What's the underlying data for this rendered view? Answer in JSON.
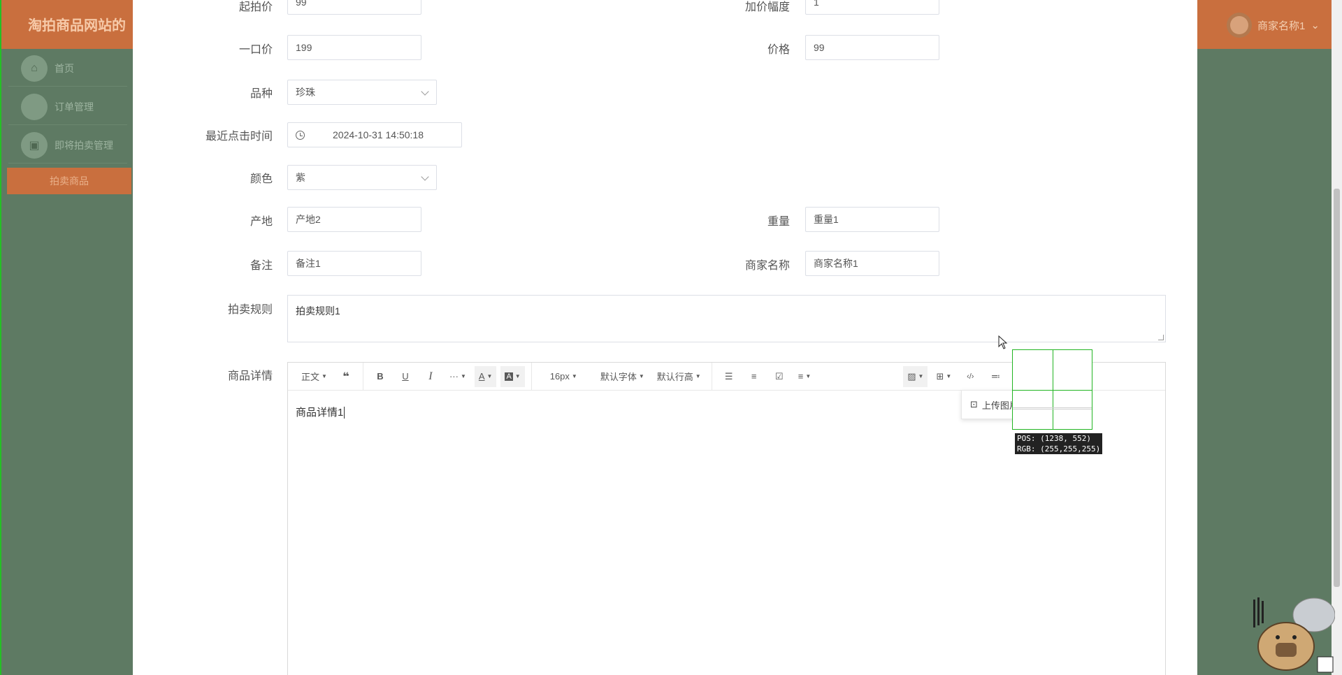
{
  "background_app": {
    "site_title": "淘拍商品网站的",
    "sidebar": [
      {
        "label": "首页",
        "icon": "home-icon"
      },
      {
        "label": "订单管理",
        "icon": "order-icon"
      },
      {
        "label": "即将拍卖管理",
        "icon": "briefcase-icon"
      }
    ],
    "active_menu": "拍卖商品",
    "user_name": "商家名称1"
  },
  "form": {
    "start_price": {
      "label": "起拍价",
      "value": "99"
    },
    "bid_increment": {
      "label": "加价幅度",
      "value": "1"
    },
    "buyout_price": {
      "label": "一口价",
      "value": "199"
    },
    "price": {
      "label": "价格",
      "value": "99"
    },
    "variety": {
      "label": "品种",
      "value": "珍珠"
    },
    "last_click_time": {
      "label": "最近点击时间",
      "value": "2024-10-31 14:50:18"
    },
    "color": {
      "label": "颜色",
      "value": "紫"
    },
    "origin": {
      "label": "产地",
      "value": "产地2"
    },
    "weight": {
      "label": "重量",
      "value": "重量1"
    },
    "remark": {
      "label": "备注",
      "value": "备注1"
    },
    "merchant_name": {
      "label": "商家名称",
      "value": "商家名称1"
    },
    "auction_rules": {
      "label": "拍卖规则",
      "value": "拍卖规则1"
    },
    "product_details": {
      "label": "商品详情",
      "value": "商品详情1"
    }
  },
  "editor_toolbar": {
    "paragraph": "正文",
    "font_size": "16px",
    "font_family": "默认字体",
    "line_height": "默认行高",
    "more": "···"
  },
  "image_menu": {
    "upload_label": "上传图片"
  },
  "pos_tooltip": {
    "pos": "POS:  (1238, 552)",
    "rgb": "RGB:  (255,255,255)"
  }
}
